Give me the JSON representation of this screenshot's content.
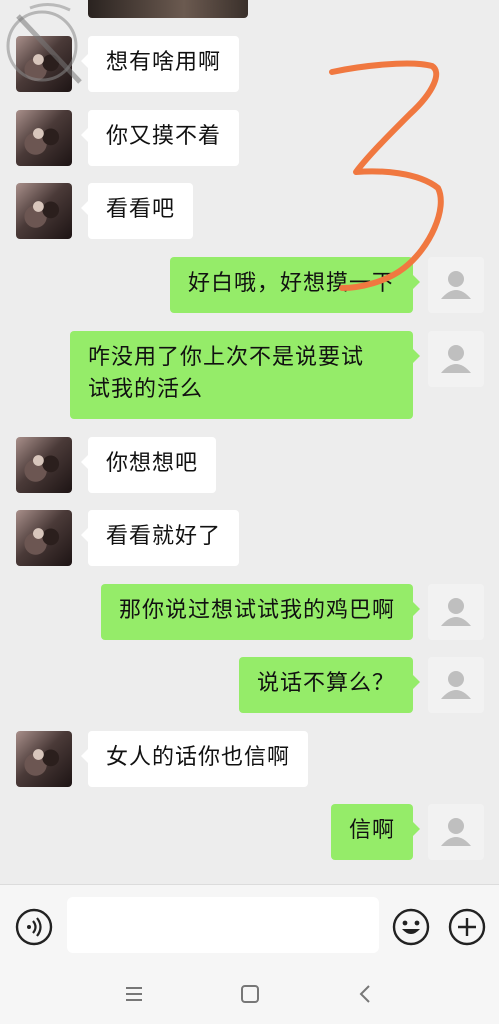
{
  "messages": [
    {
      "side": "in",
      "text": "想有啥用啊"
    },
    {
      "side": "in",
      "text": "你又摸不着"
    },
    {
      "side": "in",
      "text": "看看吧"
    },
    {
      "side": "out",
      "text": "好白哦，好想摸一下"
    },
    {
      "side": "out",
      "text_line1": "咋没用了你上次不是说要试",
      "text_line2": "试我的活么"
    },
    {
      "side": "in",
      "text": "你想想吧"
    },
    {
      "side": "in",
      "text": "看看就好了"
    },
    {
      "side": "out",
      "text": "那你说过想试试我的鸡巴啊"
    },
    {
      "side": "out",
      "text": "说话不算么？"
    },
    {
      "side": "in",
      "text": "女人的话你也信啊"
    },
    {
      "side": "out",
      "text": "信啊"
    }
  ],
  "input": {
    "value": "",
    "placeholder": ""
  },
  "icons": {
    "voice": "voice-icon",
    "emoji": "emoji-icon",
    "plus": "plus-icon",
    "nav_menu": "menu-icon",
    "nav_home": "home-icon",
    "nav_back": "back-icon"
  },
  "colors": {
    "outgoing_bubble": "#95ec69",
    "incoming_bubble": "#ffffff",
    "background": "#ededed",
    "annotation": "#f07840"
  }
}
